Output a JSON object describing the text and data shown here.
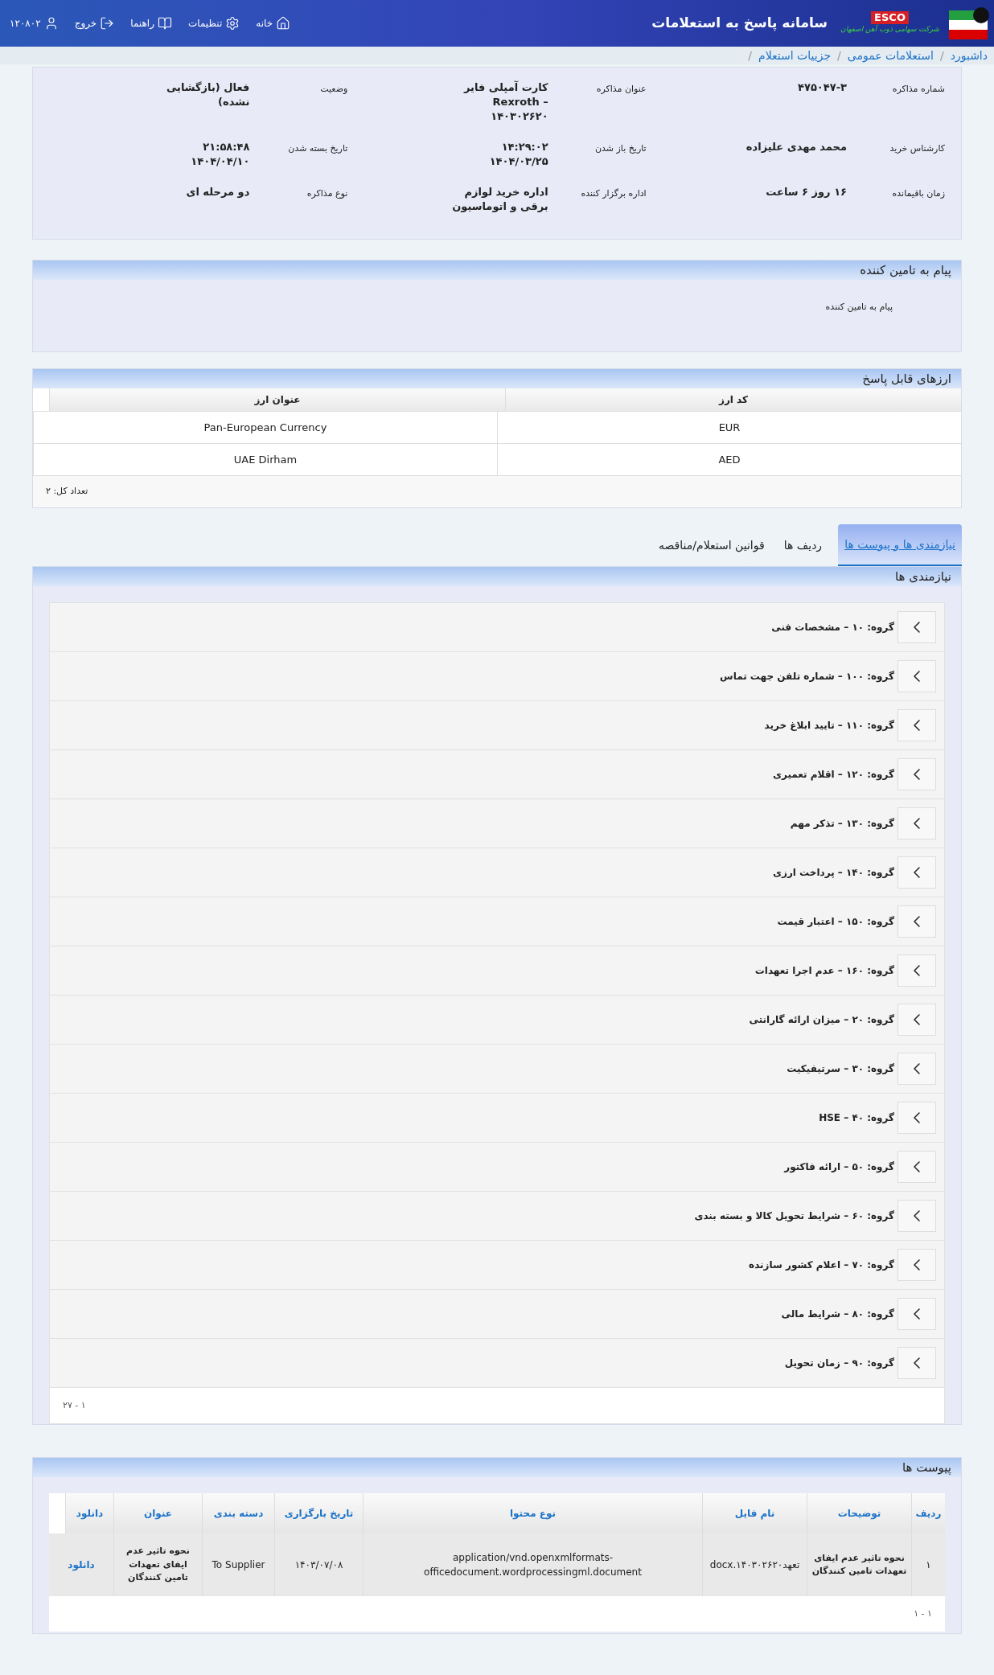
{
  "header": {
    "title": "سامانه پاسخ به استعلامات",
    "logo_text": "ESCO",
    "company_name": "شرکت سهامی ذوب آهن اصفهان",
    "user_id": "۱۲۰۸۰۲",
    "nav": [
      {
        "label": "خانه",
        "kind": "home"
      },
      {
        "label": "تنظیمات",
        "kind": "settings"
      },
      {
        "label": "راهنما",
        "kind": "help"
      },
      {
        "label": "خروج",
        "kind": "logout"
      }
    ]
  },
  "breadcrumb": {
    "separator": "/",
    "items": [
      "داشبورد",
      "استعلامات عمومی",
      "جزییات استعلام"
    ]
  },
  "details": [
    {
      "label": "شماره مذاکره",
      "value": "۴۷۵۰۴۷-۳"
    },
    {
      "label": "عنوان مذاکره",
      "value": "کارت آمپلی فایر Rexroth – ۱۴۰۳۰۲۶۲۰"
    },
    {
      "label": "وضعیت",
      "value": "فعال (بازگشایی نشده)"
    },
    {
      "label": "کارشناس خرید",
      "value": "محمد مهدی علیزاده"
    },
    {
      "label": "تاریخ باز شدن",
      "value": "۱۴:۲۹:۰۲ ۱۴۰۴/۰۳/۲۵"
    },
    {
      "label": "تاریخ بسته شدن",
      "value": "۲۱:۵۸:۴۸ ۱۴۰۴/۰۴/۱۰"
    },
    {
      "label": "زمان باقیمانده",
      "value": "۱۶ روز ۶ ساعت"
    },
    {
      "label": "اداره برگزار کننده",
      "value": "اداره خرید لوازم برقی و اتوماسیون"
    },
    {
      "label": "نوع مذاکره",
      "value": "دو مرحله ای"
    }
  ],
  "supplier_message": {
    "title": "پیام به تامین کننده",
    "text": "پیام به تامین کننده"
  },
  "currencies": {
    "title": "ارزهای قابل پاسخ",
    "columns": [
      "کد ارز",
      "عنوان ارز"
    ],
    "rows": [
      [
        "EUR",
        "Pan-European Currency"
      ],
      [
        "AED",
        "UAE Dirham"
      ]
    ],
    "total": "تعداد کل: ۲"
  },
  "tabs": [
    {
      "label": "نیازمندی ها و پیوست ها",
      "selected": true
    },
    {
      "label": "ردیف ها",
      "selected": false
    },
    {
      "label": "قوانین استعلام/مناقصه",
      "selected": false
    }
  ],
  "needs": {
    "title": "نیازمندی ها",
    "groups": [
      "گروه: ۱۰ – مشخصات فنی",
      "گروه: ۱۰۰ – شماره تلفن جهت تماس",
      "گروه: ۱۱۰ – تایید ابلاغ خرید",
      "گروه: ۱۲۰ – اقلام تعمیری",
      "گروه: ۱۳۰ – تذکر مهم",
      "گروه: ۱۴۰ – پرداخت ارزی",
      "گروه: ۱۵۰ – اعتبار قیمت",
      "گروه: ۱۶۰ – عدم اجرا تعهدات",
      "گروه: ۲۰ – میزان ارائه گارانتی",
      "گروه: ۳۰ – سرتیفیکیت",
      "گروه: ۴۰ – HSE",
      "گروه: ۵۰ – ارائه فاکتور",
      "گروه: ۶۰ – شرایط تحویل کالا و بسته بندی",
      "گروه: ۷۰ – اعلام کشور سازنده",
      "گروه: ۸۰ – شرایط مالی",
      "گروه: ۹۰ – زمان تحویل"
    ],
    "pagination": "۱ - ۲۷"
  },
  "attachments": {
    "title": "پیوست ها",
    "columns": [
      "ردیف",
      "توضیحات",
      "نام فایل",
      "نوع محتوا",
      "تاریخ بارگزاری",
      "دسته بندی",
      "عنوان",
      "دانلود"
    ],
    "rows": [
      {
        "cells": [
          "۱",
          "نحوه تاثیر عدم ایفای تعهدات تامین کنندگان",
          "تعهد۱۴۰۳۰۲۶۲۰.docx",
          "application/vnd.openxmlformats-officedocument.wordprocessingml.document",
          "۱۴۰۳/۰۷/۰۸",
          "To Supplier",
          "نحوه تاثیر عدم ایفای تعهدات تامین کنندگان"
        ],
        "download": "دانلود"
      }
    ],
    "pagination": "۱ - ۱"
  }
}
